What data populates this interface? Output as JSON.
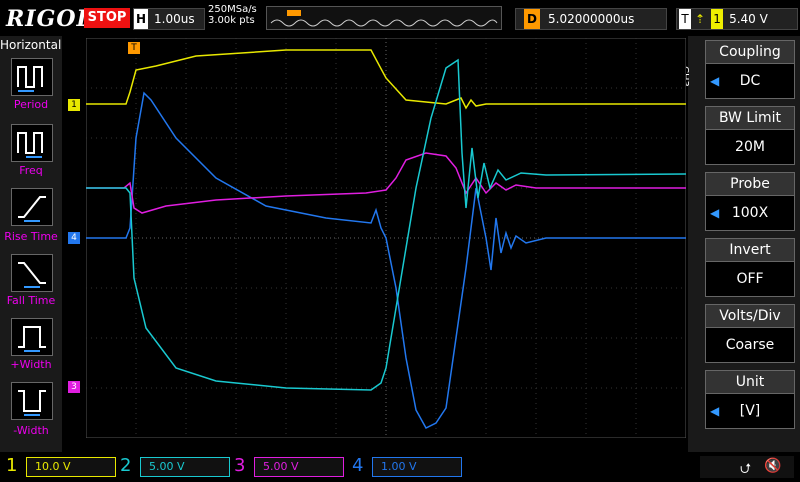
{
  "brand": "RIGOL",
  "run_state": "STOP",
  "horizontal": {
    "key": "H",
    "timebase": "1.00us",
    "sample_rate": "250MSa/s",
    "mem_depth": "3.00k pts"
  },
  "delay": {
    "key": "D",
    "value": "5.02000000us"
  },
  "trigger": {
    "key": "T",
    "source": "1",
    "level": "5.40 V"
  },
  "left_panel": {
    "title": "Horizontal",
    "items": [
      {
        "label": "Period",
        "icon": "period-icon"
      },
      {
        "label": "Freq",
        "icon": "freq-icon"
      },
      {
        "label": "Rise Time",
        "icon": "rise-time-icon"
      },
      {
        "label": "Fall Time",
        "icon": "fall-time-icon"
      },
      {
        "label": "+Width",
        "icon": "positive-width-icon"
      },
      {
        "label": "-Width",
        "icon": "negative-width-icon"
      }
    ]
  },
  "right_panel": {
    "channel_tag": "CH3",
    "items": [
      {
        "label": "Coupling",
        "value": "DC"
      },
      {
        "label": "BW Limit",
        "value": "20M"
      },
      {
        "label": "Probe",
        "value": "100X"
      },
      {
        "label": "Invert",
        "value": "OFF"
      },
      {
        "label": "Volts/Div",
        "value": "Coarse"
      },
      {
        "label": "Unit",
        "value": "[V]"
      }
    ]
  },
  "channels": [
    {
      "num": "1",
      "scale": "10.0 V",
      "color": "#e8e800"
    },
    {
      "num": "2",
      "scale": "5.00 V",
      "color": "#19c9d0"
    },
    {
      "num": "3",
      "scale": "5.00 V",
      "color": "#e01ee0"
    },
    {
      "num": "4",
      "scale": "1.00 V",
      "color": "#2277ee"
    }
  ],
  "markers": {
    "ch1": "1",
    "ch3": "3",
    "ch4": "4",
    "trig": "T"
  }
}
